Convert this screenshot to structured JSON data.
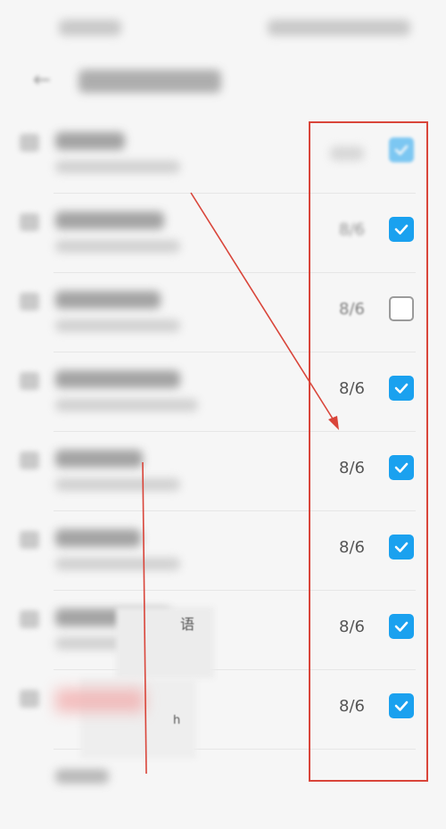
{
  "status_bar": {
    "left": "",
    "right": ""
  },
  "header": {
    "back_icon": "back-arrow-icon",
    "title": ""
  },
  "rows": [
    {
      "name": "",
      "subtitle": "",
      "date": "",
      "checked": true
    },
    {
      "name": "",
      "subtitle": "",
      "date": "8/6",
      "checked": true
    },
    {
      "name": "",
      "subtitle": "",
      "date": "8/6",
      "checked": false
    },
    {
      "name": "",
      "subtitle": "",
      "date": "8/6",
      "checked": true
    },
    {
      "name": "",
      "subtitle": "",
      "date": "8/6",
      "checked": true
    },
    {
      "name": "",
      "subtitle": "",
      "date": "8/6",
      "checked": true
    },
    {
      "name": "",
      "subtitle": "",
      "date": "8/6",
      "checked": true
    },
    {
      "name": "",
      "subtitle": "",
      "date": "8/6",
      "checked": true
    }
  ],
  "fragments": {
    "a": "语",
    "b": "h"
  },
  "colors": {
    "checkbox_on": "#1aa1ef",
    "annotation_red": "#d9453a"
  }
}
